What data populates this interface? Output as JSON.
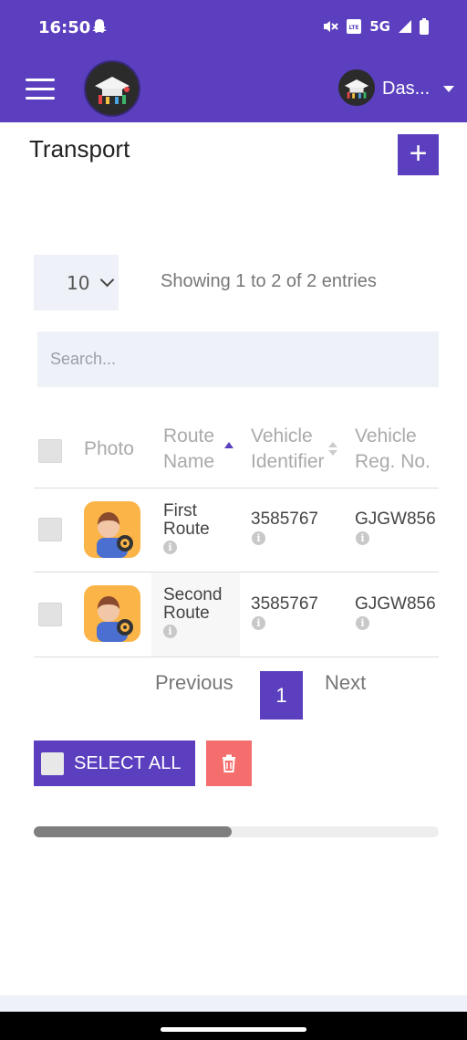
{
  "status_bar": {
    "time": "16:50",
    "network": "5G"
  },
  "header": {
    "user_name": "Das..."
  },
  "page": {
    "title": "Transport",
    "add_label": "+"
  },
  "table_controls": {
    "page_length": "10",
    "info": "Showing 1 to 2 of 2 entries",
    "search_placeholder": "Search..."
  },
  "table": {
    "columns": {
      "photo": "Photo",
      "route_name_1": "Route",
      "route_name_2": "Name",
      "vehicle_identifier_1": "Vehicle",
      "vehicle_identifier_2": "Identifier",
      "vehicle_reg_1": "Vehicle",
      "vehicle_reg_2": "Reg. No."
    },
    "rows": [
      {
        "route_1": "First",
        "route_2": "Route",
        "identifier": "3585767",
        "reg": "GJGW856"
      },
      {
        "route_1": "Second",
        "route_2": "Route",
        "identifier": "3585767",
        "reg": "GJGW856"
      }
    ]
  },
  "pagination": {
    "previous": "Previous",
    "current": "1",
    "next": "Next"
  },
  "bulk": {
    "select_all": "SELECT ALL"
  },
  "colors": {
    "primary": "#5b3fbf",
    "danger": "#f56e6e",
    "avatar_bg": "#fbb447"
  },
  "icons": [
    "menu-icon",
    "app-logo",
    "user-avatar",
    "caret-down-icon",
    "plus-icon",
    "chevron-down-icon",
    "sort-asc-icon",
    "sort-icon",
    "info-icon",
    "driver-avatar",
    "trash-icon"
  ]
}
